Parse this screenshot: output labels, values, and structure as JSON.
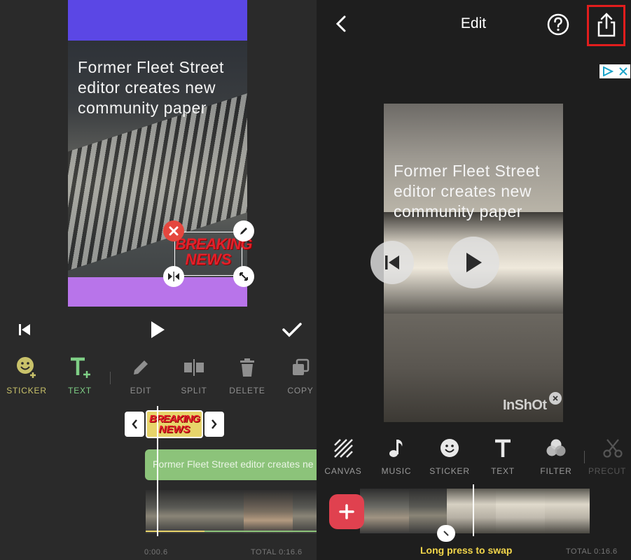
{
  "left": {
    "overlay_text_lines": [
      "Former Fleet Street",
      "editor creates new",
      "community paper"
    ],
    "sticker_text_lines": [
      "BREAKING",
      "NEWS"
    ],
    "tools": [
      {
        "label": "STICKER",
        "icon": "sticker-add-icon",
        "color": "#c9c26a"
      },
      {
        "label": "TEXT",
        "icon": "text-add-icon",
        "color": "#7fcf86"
      },
      {
        "label": "EDIT",
        "icon": "pencil-icon",
        "color": "#8f8f8f"
      },
      {
        "label": "SPLIT",
        "icon": "split-icon",
        "color": "#8f8f8f"
      },
      {
        "label": "DELETE",
        "icon": "trash-icon",
        "color": "#8f8f8f"
      },
      {
        "label": "COPY",
        "icon": "copy-icon",
        "color": "#8f8f8f"
      }
    ],
    "sticker_clip_text_lines": [
      "BREAKING",
      "NEWS"
    ],
    "text_clip": "Former Fleet Street editor creates ne",
    "current_time": "0:00.6",
    "total_time": "TOTAL 0:16.6"
  },
  "right": {
    "header_title": "Edit",
    "overlay_text_lines": [
      "Former Fleet Street",
      "editor creates new",
      "community paper"
    ],
    "watermark": "InShOt",
    "tools": [
      {
        "label": "CANVAS",
        "icon": "canvas-icon"
      },
      {
        "label": "MUSIC",
        "icon": "music-note-icon"
      },
      {
        "label": "STICKER",
        "icon": "sticker-icon"
      },
      {
        "label": "TEXT",
        "icon": "text-icon"
      },
      {
        "label": "FILTER",
        "icon": "filter-icon"
      },
      {
        "label": "PRECUT",
        "icon": "scissors-icon"
      }
    ],
    "swap_hint": "Long press to swap",
    "total_time": "TOTAL 0:16.6"
  },
  "colors": {
    "accent_red": "#e0414f",
    "hint_yellow": "#f2d64b",
    "text_clip_green": "#8cc37a",
    "sticker_clip_yellow": "#e7d46a",
    "highlight_border": "#e21d1d"
  }
}
